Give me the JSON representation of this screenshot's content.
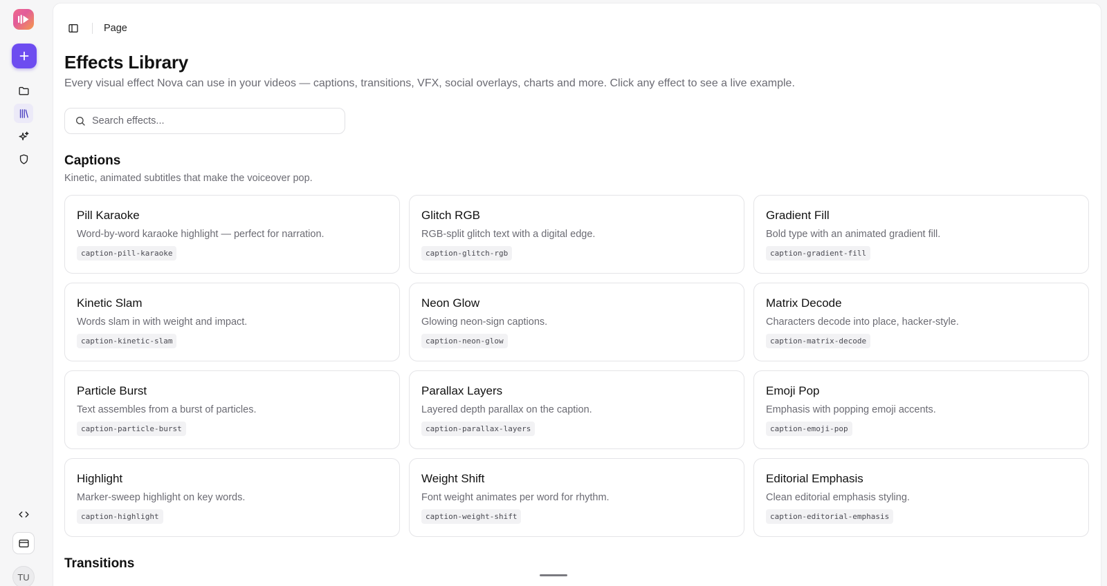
{
  "sidebar": {
    "icons": [
      "logo-icon",
      "plus-icon",
      "folder-icon",
      "library-icon",
      "sparkles-icon",
      "shield-icon",
      "code-icon",
      "card-icon"
    ],
    "avatar_initials": "TU"
  },
  "topbar": {
    "breadcrumb": "Page"
  },
  "header": {
    "title": "Effects Library",
    "subtitle": "Every visual effect Nova can use in your videos — captions, transitions, VFX, social overlays, charts and more. Click any effect to see a live example."
  },
  "search": {
    "placeholder": "Search effects...",
    "value": ""
  },
  "sections": [
    {
      "title": "Captions",
      "description": "Kinetic, animated subtitles that make the voiceover pop.",
      "effects": [
        {
          "name": "Pill Karaoke",
          "description": "Word-by-word karaoke highlight — perfect for narration.",
          "id": "caption-pill-karaoke"
        },
        {
          "name": "Glitch RGB",
          "description": "RGB-split glitch text with a digital edge.",
          "id": "caption-glitch-rgb"
        },
        {
          "name": "Gradient Fill",
          "description": "Bold type with an animated gradient fill.",
          "id": "caption-gradient-fill"
        },
        {
          "name": "Kinetic Slam",
          "description": "Words slam in with weight and impact.",
          "id": "caption-kinetic-slam"
        },
        {
          "name": "Neon Glow",
          "description": "Glowing neon-sign captions.",
          "id": "caption-neon-glow"
        },
        {
          "name": "Matrix Decode",
          "description": "Characters decode into place, hacker-style.",
          "id": "caption-matrix-decode"
        },
        {
          "name": "Particle Burst",
          "description": "Text assembles from a burst of particles.",
          "id": "caption-particle-burst"
        },
        {
          "name": "Parallax Layers",
          "description": "Layered depth parallax on the caption.",
          "id": "caption-parallax-layers"
        },
        {
          "name": "Emoji Pop",
          "description": "Emphasis with popping emoji accents.",
          "id": "caption-emoji-pop"
        },
        {
          "name": "Highlight",
          "description": "Marker-sweep highlight on key words.",
          "id": "caption-highlight"
        },
        {
          "name": "Weight Shift",
          "description": "Font weight animates per word for rhythm.",
          "id": "caption-weight-shift"
        },
        {
          "name": "Editorial Emphasis",
          "description": "Clean editorial emphasis styling.",
          "id": "caption-editorial-emphasis"
        }
      ]
    },
    {
      "title": "Transitions"
    }
  ],
  "colors": {
    "accent": "#6d4cf0",
    "background": "#f6f6f7",
    "card_border": "#e4e4e7"
  }
}
